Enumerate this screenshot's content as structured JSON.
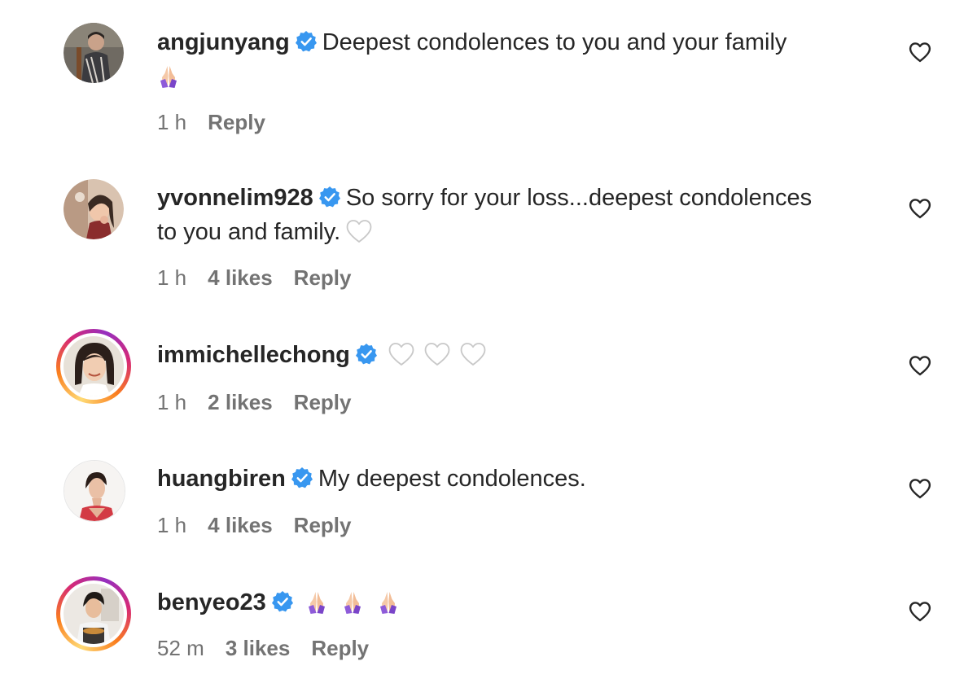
{
  "comments": [
    {
      "username": "angjunyang",
      "text_line1": "Deepest condolences to you and your family",
      "time": "1 h",
      "likes": "",
      "reply": "Reply",
      "emojis": [
        "folded-hands"
      ]
    },
    {
      "username": "yvonnelim928",
      "text_line1": "So sorry for your loss...deepest condolences",
      "text_line2": "to you and family.",
      "time": "1 h",
      "likes": "4 likes",
      "reply": "Reply",
      "emojis": [
        "white-heart"
      ]
    },
    {
      "username": "immichellechong",
      "text_line1": "",
      "time": "1 h",
      "likes": "2 likes",
      "reply": "Reply",
      "emojis": [
        "white-heart",
        "white-heart",
        "white-heart"
      ]
    },
    {
      "username": "huangbiren",
      "text_line1": "My deepest condolences.",
      "time": "1 h",
      "likes": "4 likes",
      "reply": "Reply",
      "emojis": []
    },
    {
      "username": "benyeo23",
      "text_line1": "",
      "time": "52 m",
      "likes": "3 likes",
      "reply": "Reply",
      "emojis": [
        "folded-hands",
        "folded-hands",
        "folded-hands"
      ]
    }
  ],
  "colors": {
    "text": "#262626",
    "meta": "#737373",
    "verified": "#3897f0",
    "story_ring": [
      "#feda75",
      "#fa7e1e",
      "#d62976",
      "#962fbf"
    ]
  },
  "icons": {
    "like": "heart-outline-icon",
    "verified": "verified-badge-icon"
  }
}
